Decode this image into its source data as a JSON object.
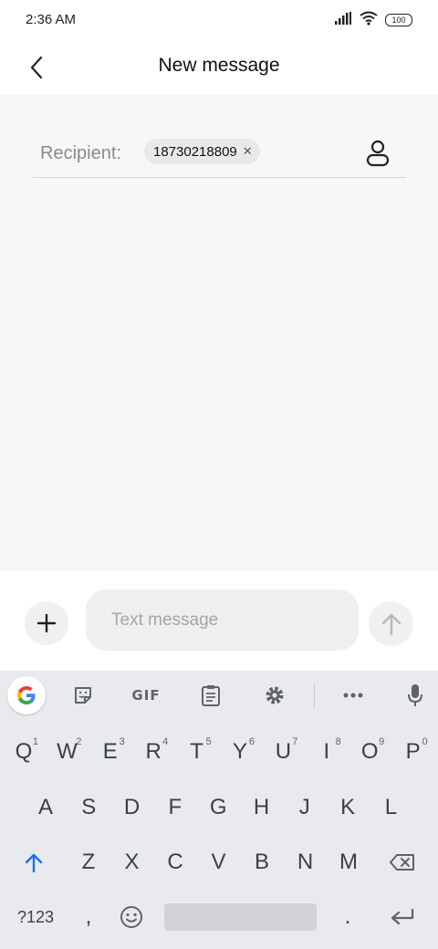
{
  "status_bar": {
    "time": "2:36 AM",
    "battery": "100"
  },
  "header": {
    "title": "New message"
  },
  "recipient": {
    "label": "Recipient:",
    "chip": "18730218809"
  },
  "compose": {
    "placeholder": "Text message"
  },
  "keyboard": {
    "toolbar": {
      "gif": "GIF"
    },
    "row1": [
      {
        "k": "Q",
        "h": "1"
      },
      {
        "k": "W",
        "h": "2"
      },
      {
        "k": "E",
        "h": "3"
      },
      {
        "k": "R",
        "h": "4"
      },
      {
        "k": "T",
        "h": "5"
      },
      {
        "k": "Y",
        "h": "6"
      },
      {
        "k": "U",
        "h": "7"
      },
      {
        "k": "I",
        "h": "8"
      },
      {
        "k": "O",
        "h": "9"
      },
      {
        "k": "P",
        "h": "0"
      }
    ],
    "row2": [
      "A",
      "S",
      "D",
      "F",
      "G",
      "H",
      "J",
      "K",
      "L"
    ],
    "row3": [
      "Z",
      "X",
      "C",
      "V",
      "B",
      "N",
      "M"
    ],
    "row4": {
      "symbols": "?123",
      "comma": ",",
      "period": "."
    }
  },
  "colors": {
    "accent_shift": "#1a73e8",
    "background": "#f7f7f7",
    "keyboard": "#e8eaed"
  },
  "icons": [
    "signal-icon",
    "wifi-icon",
    "battery-icon",
    "back-arrow-icon",
    "contact-icon",
    "plus-icon",
    "send-arrow-icon",
    "google-icon",
    "sticker-icon",
    "clipboard-icon",
    "settings-icon",
    "more-icon",
    "mic-icon",
    "shift-icon",
    "backspace-icon",
    "emoji-icon",
    "enter-icon"
  ]
}
